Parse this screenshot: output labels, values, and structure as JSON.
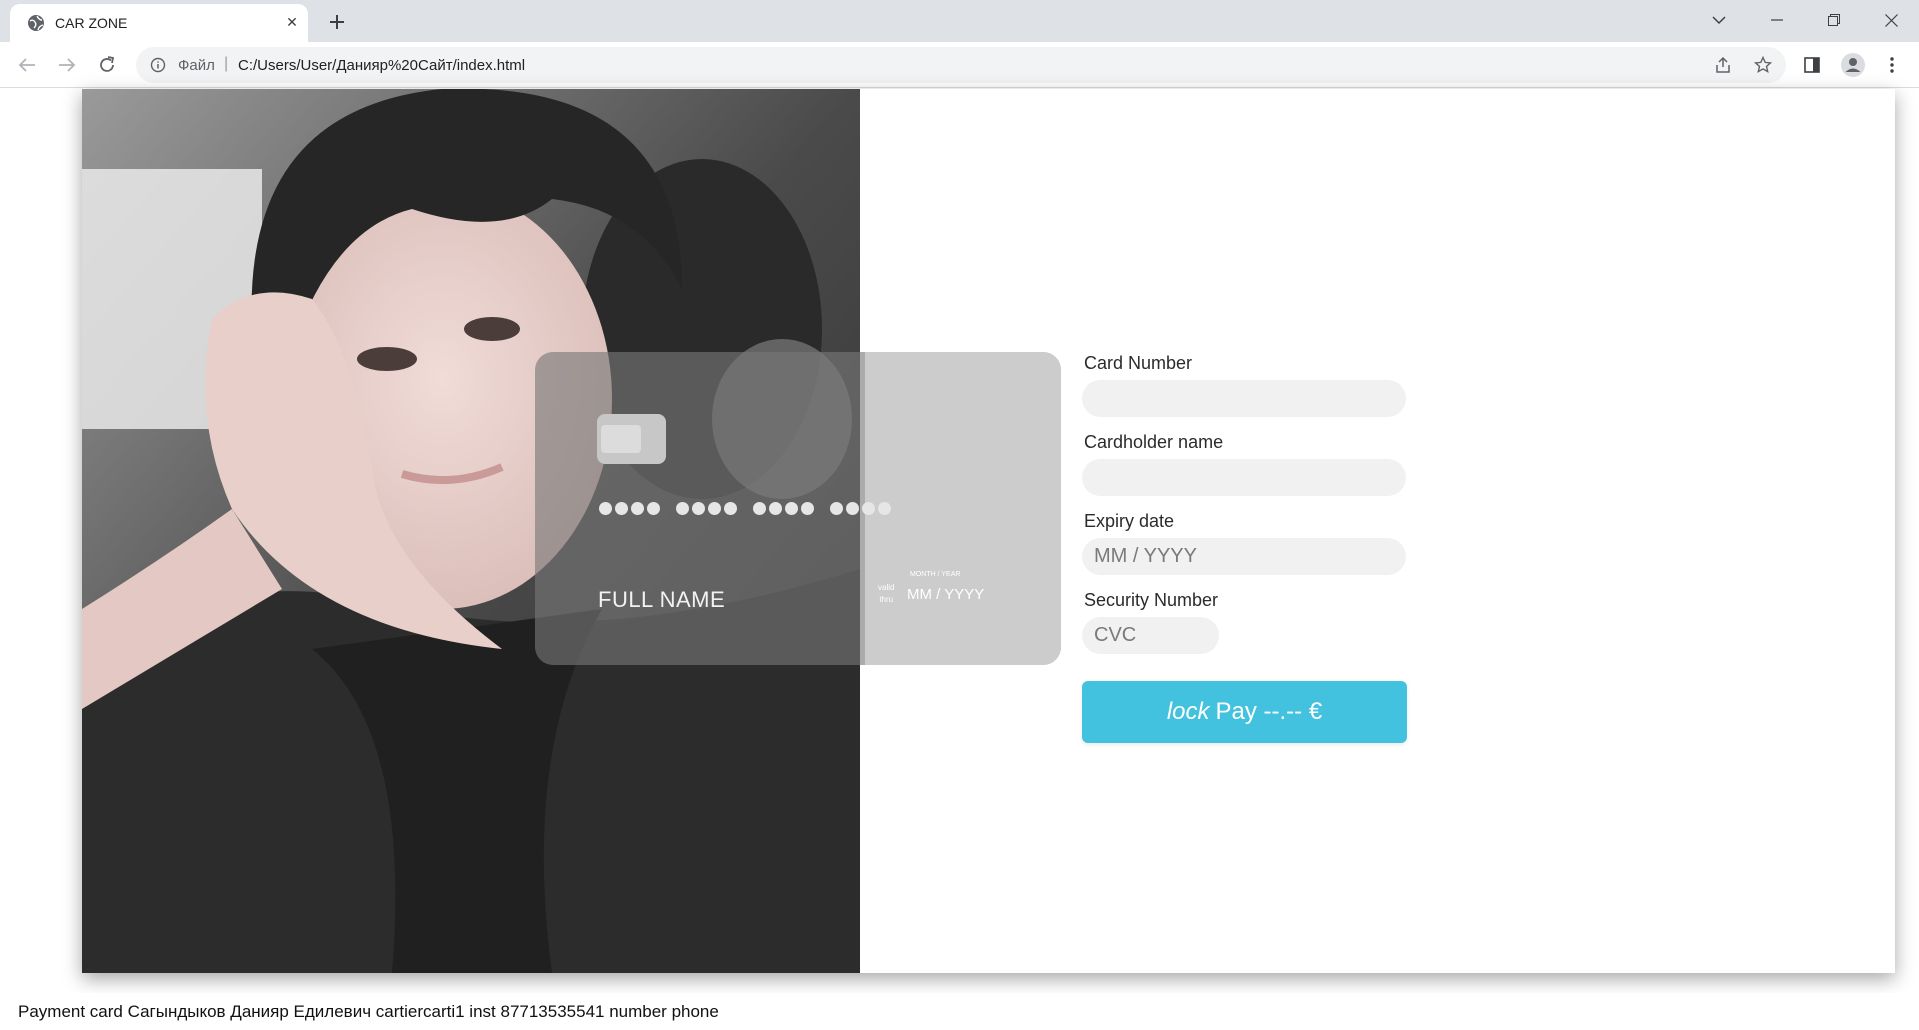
{
  "browser": {
    "tab_title": "CAR ZONE",
    "close_symbol": "✕",
    "scheme_label": "Файл",
    "separator": "|",
    "url": "C:/Users/User/Данияр%20Сайт/index.html"
  },
  "icons": {
    "favicon": "globe-icon",
    "new_tab": "plus-icon",
    "back": "arrow-left-icon",
    "forward": "arrow-right-icon",
    "reload": "reload-icon",
    "info": "info-icon",
    "share": "share-icon",
    "bookmark": "star-icon",
    "side_panel": "side-panel-icon",
    "profile": "profile-icon",
    "menu": "kebab-menu-icon"
  },
  "card": {
    "full_name": "FULL NAME",
    "valid_line1": "valid",
    "valid_line2": "thru",
    "month_year_label": "MONTH / YEAR",
    "expiry": "MM / YYYY"
  },
  "form": {
    "card_number_label": "Card Number",
    "card_number_value": "",
    "cardholder_label": "Cardholder name",
    "cardholder_value": "",
    "expiry_label": "Expiry date",
    "expiry_placeholder": "MM / YYYY",
    "security_label": "Security Number",
    "security_placeholder": "CVC",
    "pay_lock_text": "lock",
    "pay_text": "Pay --.-- €"
  },
  "footer": {
    "text": "Payment card Сагындыков Данияр Едилевич cartiercarti1 inst 87713535541 number phone"
  },
  "colors": {
    "pay_button": "#42c2df",
    "input_bg": "#f1f1f1",
    "chrome_bg": "#dee1e6"
  }
}
